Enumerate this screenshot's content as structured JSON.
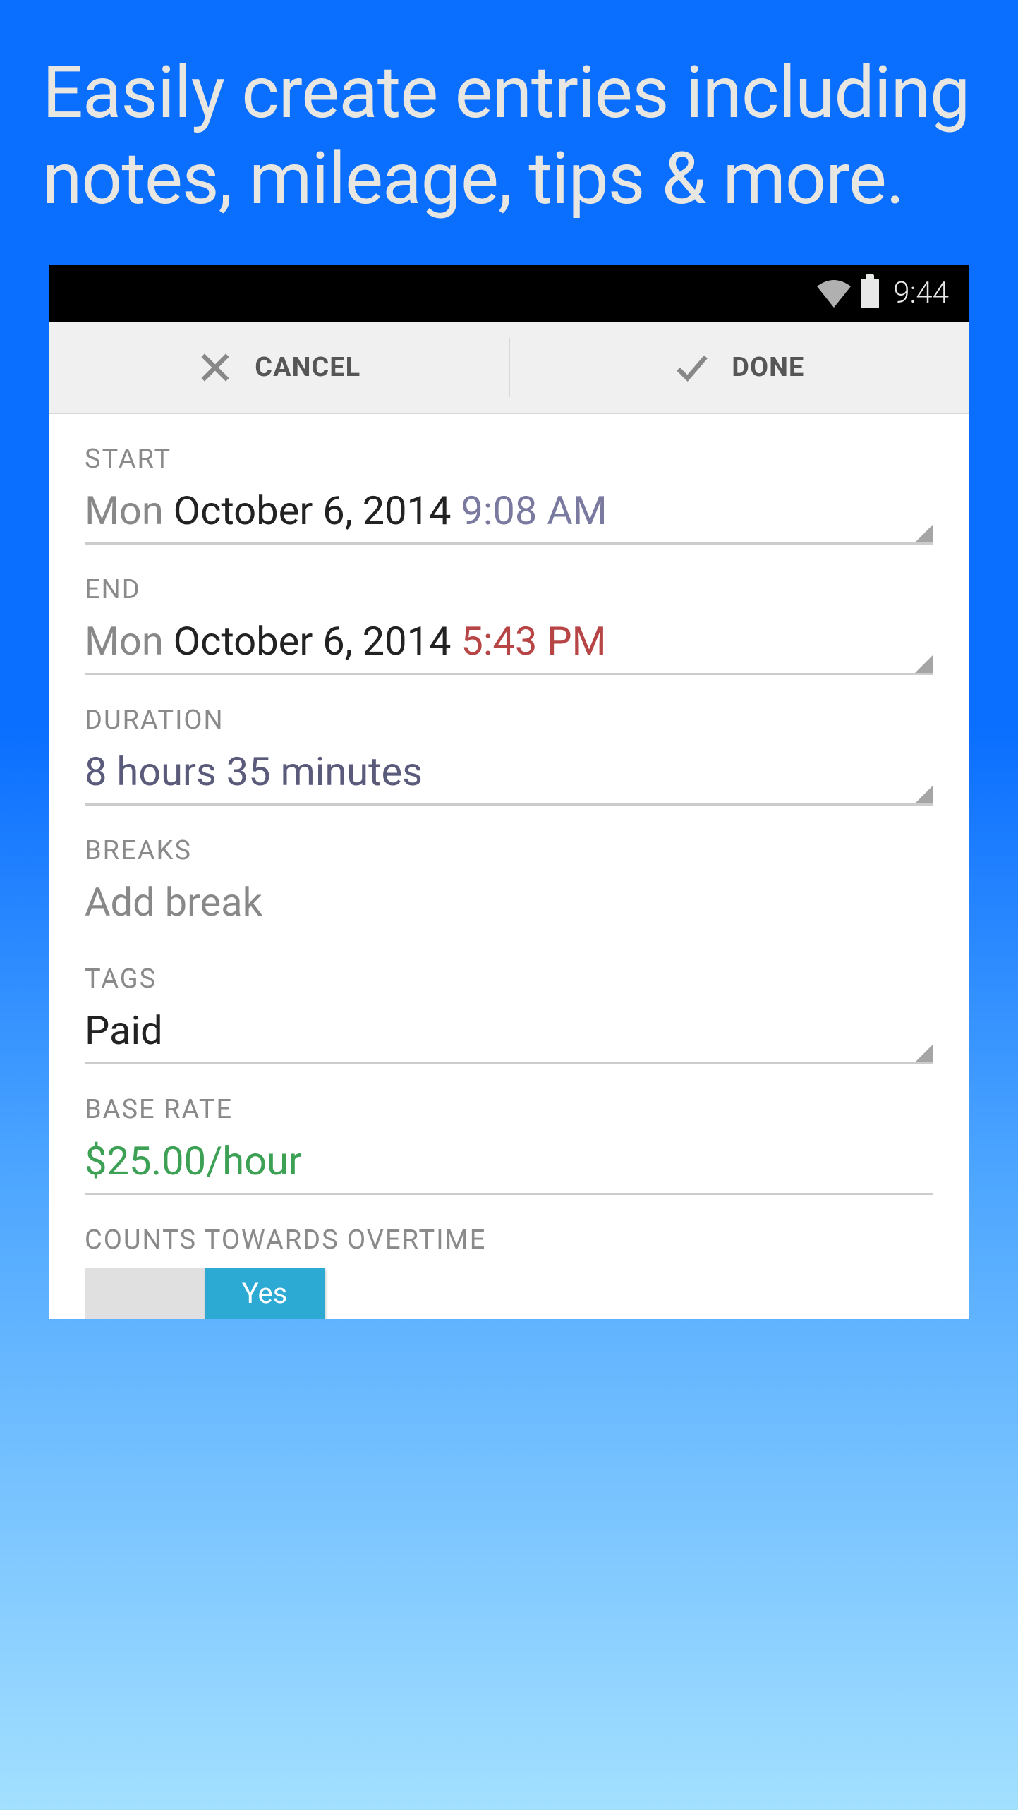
{
  "marketing": {
    "headline": "Easily create entries including notes, mileage, tips & more."
  },
  "statusBar": {
    "time": "9:44"
  },
  "actionBar": {
    "cancel": "CANCEL",
    "done": "DONE"
  },
  "form": {
    "start": {
      "label": "START",
      "day": "Mon",
      "date": "October 6, 2014",
      "time": "9:08 AM"
    },
    "end": {
      "label": "END",
      "day": "Mon",
      "date": "October 6, 2014",
      "time": "5:43 PM"
    },
    "duration": {
      "label": "DURATION",
      "value": "8 hours 35 minutes"
    },
    "breaks": {
      "label": "BREAKS",
      "action": "Add break"
    },
    "tags": {
      "label": "TAGS",
      "value": "Paid"
    },
    "baseRate": {
      "label": "BASE RATE",
      "value": "$25.00/hour"
    },
    "overtime": {
      "label": "COUNTS TOWARDS OVERTIME",
      "yes": "Yes"
    }
  }
}
